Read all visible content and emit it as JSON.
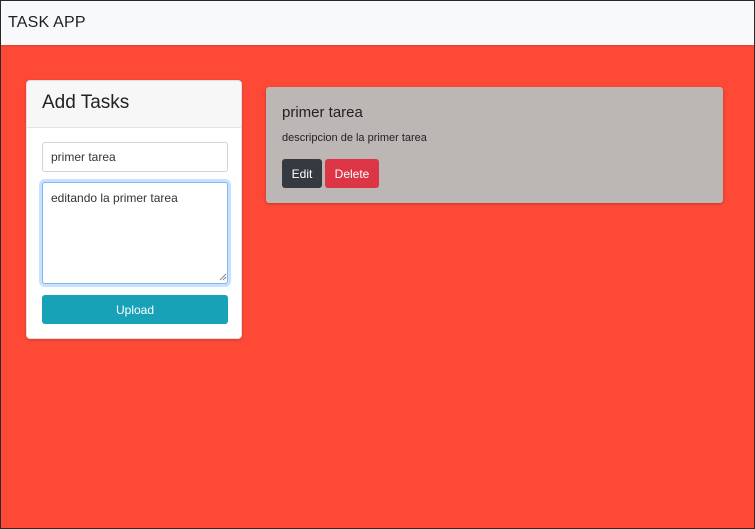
{
  "navbar": {
    "brand": "TASK APP"
  },
  "form": {
    "header": "Add Tasks",
    "title_value": "primer tarea",
    "description_value": "editando la primer tarea",
    "upload_label": "Upload"
  },
  "tasks": [
    {
      "title": "primer tarea",
      "description": "descripcion de la primer tarea",
      "edit_label": "Edit",
      "delete_label": "Delete"
    }
  ],
  "colors": {
    "page_background": "#ff4937",
    "navbar_background": "#f8f9fa",
    "task_card_background": "#bcb7b5",
    "upload_button": "#17a2b8",
    "edit_button": "#343a40",
    "delete_button": "#dc3545"
  }
}
